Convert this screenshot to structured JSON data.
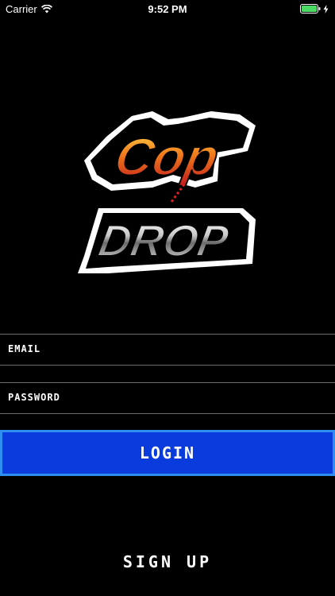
{
  "status_bar": {
    "carrier": "Carrier",
    "time": "9:52 PM",
    "icons": [
      "wifi-icon",
      "battery-icon",
      "charging-bolt-icon"
    ]
  },
  "logo": {
    "line1": "Cop",
    "line2": "DROP"
  },
  "form": {
    "email_placeholder": "EMAIL",
    "password_placeholder": "PASSWORD",
    "login_label": "LOGIN",
    "signup_label": "SIGN UP"
  },
  "colors": {
    "background": "#000000",
    "login_fill": "#0a3bdc",
    "login_border": "#2f8ff0",
    "battery": "#4cd964",
    "logo_orange": "#f0701c",
    "logo_red": "#d21c1c",
    "logo_silver": "#c8c8c8"
  }
}
